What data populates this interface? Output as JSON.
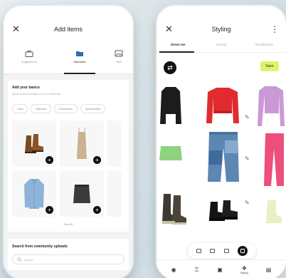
{
  "left_screen": {
    "title": "Add items",
    "close_glyph": "✕",
    "tabs": [
      {
        "label": "Suggestions",
        "icon": "bag-icon"
      },
      {
        "label": "Wardrobe",
        "icon": "folder-icon",
        "active": true
      },
      {
        "label": "Web",
        "icon": "image-icon"
      }
    ],
    "section": {
      "title": "Add your basics",
      "subtitle": "Quick add essentials to your wardrobe",
      "chips": [
        "Tops",
        "Bottoms",
        "Outerwear",
        "Accessories"
      ],
      "items": [
        {
          "name": "brown ankle boots"
        },
        {
          "name": "beige slip dress"
        },
        {
          "name": "light blue denim shirt"
        },
        {
          "name": "black denim skirt"
        }
      ],
      "see_all": "See All"
    },
    "community": {
      "title": "Search from community uploads",
      "search_placeholder": "Search"
    }
  },
  "right_screen": {
    "title": "Styling",
    "close_glyph": "✕",
    "menu_glyph": "⋮",
    "tabs": [
      {
        "label": "Dress me",
        "active": true
      },
      {
        "label": "Canvas"
      },
      {
        "label": "Moodboards"
      }
    ],
    "save_label": "Save",
    "shuffle_glyph": "⇄",
    "edit_glyph": "✎",
    "outfit_items": [
      "black knit top",
      "red cropped cardigan",
      "pink cardigan",
      "blue patchwork jeans",
      "green skirt",
      "pink trousers",
      "black combat boots",
      "black chunky boots",
      "cream boots"
    ],
    "bottom_nav": [
      {
        "label": "",
        "icon": "home-icon",
        "glyph": "◉"
      },
      {
        "label": "",
        "icon": "hanger-icon",
        "glyph": "♖"
      },
      {
        "label": "",
        "icon": "calendar-icon",
        "glyph": "▣"
      },
      {
        "label": "Styling",
        "icon": "styling-icon",
        "glyph": "❖"
      },
      {
        "label": "",
        "icon": "profile-icon",
        "glyph": "▤"
      }
    ]
  },
  "colors": {
    "accent_save": "#d9f56a",
    "dark": "#111111",
    "background": "#dbe5e9"
  }
}
